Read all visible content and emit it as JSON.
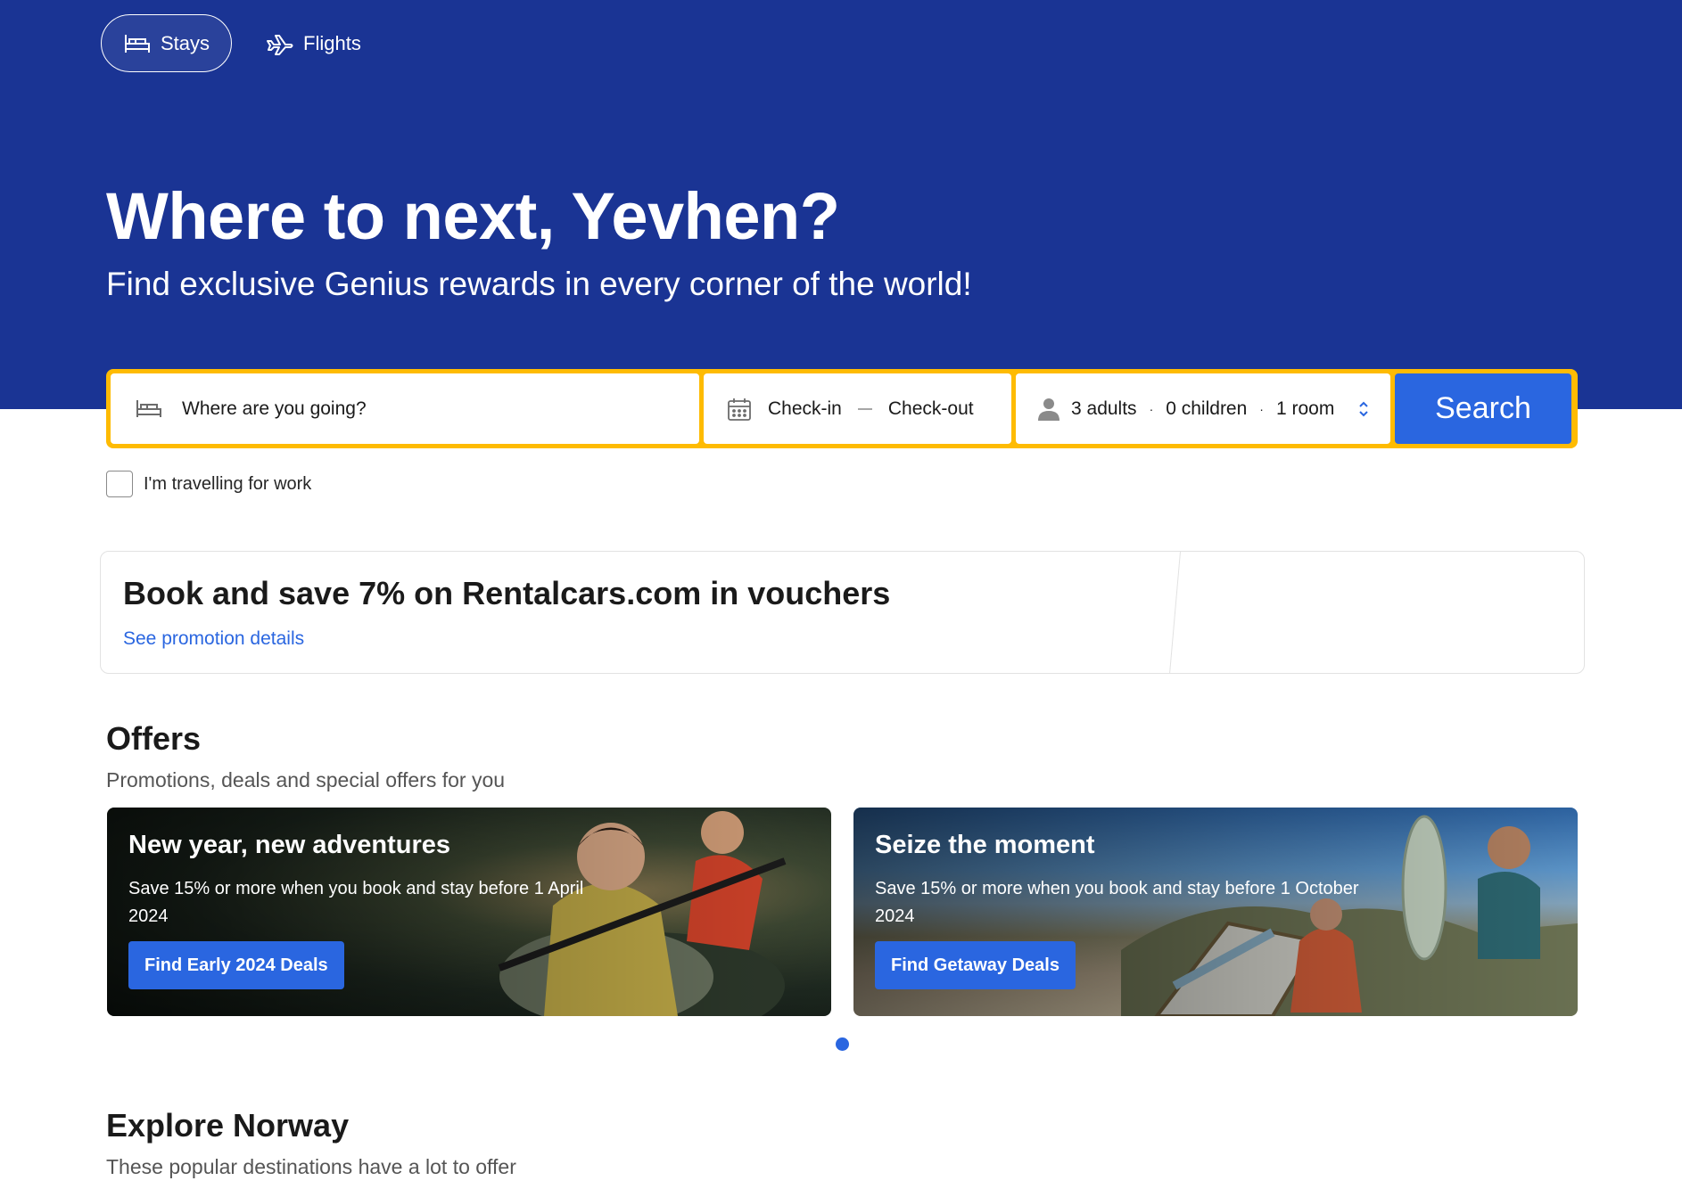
{
  "nav": {
    "tabs": [
      {
        "label": "Stays",
        "icon": "bed-icon",
        "active": true
      },
      {
        "label": "Flights",
        "icon": "airplane-icon",
        "active": false
      }
    ]
  },
  "hero": {
    "title": "Where to next, Yevhen?",
    "subtitle": "Find exclusive Genius rewards in every corner of the world!"
  },
  "search": {
    "destination_placeholder": "Where are you going?",
    "checkin_label": "Check-in",
    "checkout_label": "Check-out",
    "occupancy": {
      "adults": "3 adults",
      "children": "0 children",
      "rooms": "1 room",
      "separator": "·"
    },
    "button_label": "Search",
    "work_travel_label": "I'm travelling for work",
    "work_travel_checked": false
  },
  "promo": {
    "title": "Book and save 7% on Rentalcars.com in vouchers",
    "link_label": "See promotion details"
  },
  "offers": {
    "title": "Offers",
    "subtitle": "Promotions, deals and special offers for you",
    "cards": [
      {
        "title": "New year, new adventures",
        "text": "Save 15% or more when you book and stay before 1 April 2024",
        "button_label": "Find Early 2024 Deals"
      },
      {
        "title": "Seize the moment",
        "text": "Save 15% or more when you book and stay before 1 October 2024",
        "button_label": "Find Getaway Deals"
      }
    ],
    "pager": {
      "current_page": 1,
      "total_pages": 1
    }
  },
  "explore": {
    "title": "Explore Norway",
    "subtitle": "These popular destinations have a lot to offer"
  },
  "colors": {
    "brand_blue": "#1a3494",
    "action_blue": "#2a66e0",
    "search_border_yellow": "#febb02"
  }
}
